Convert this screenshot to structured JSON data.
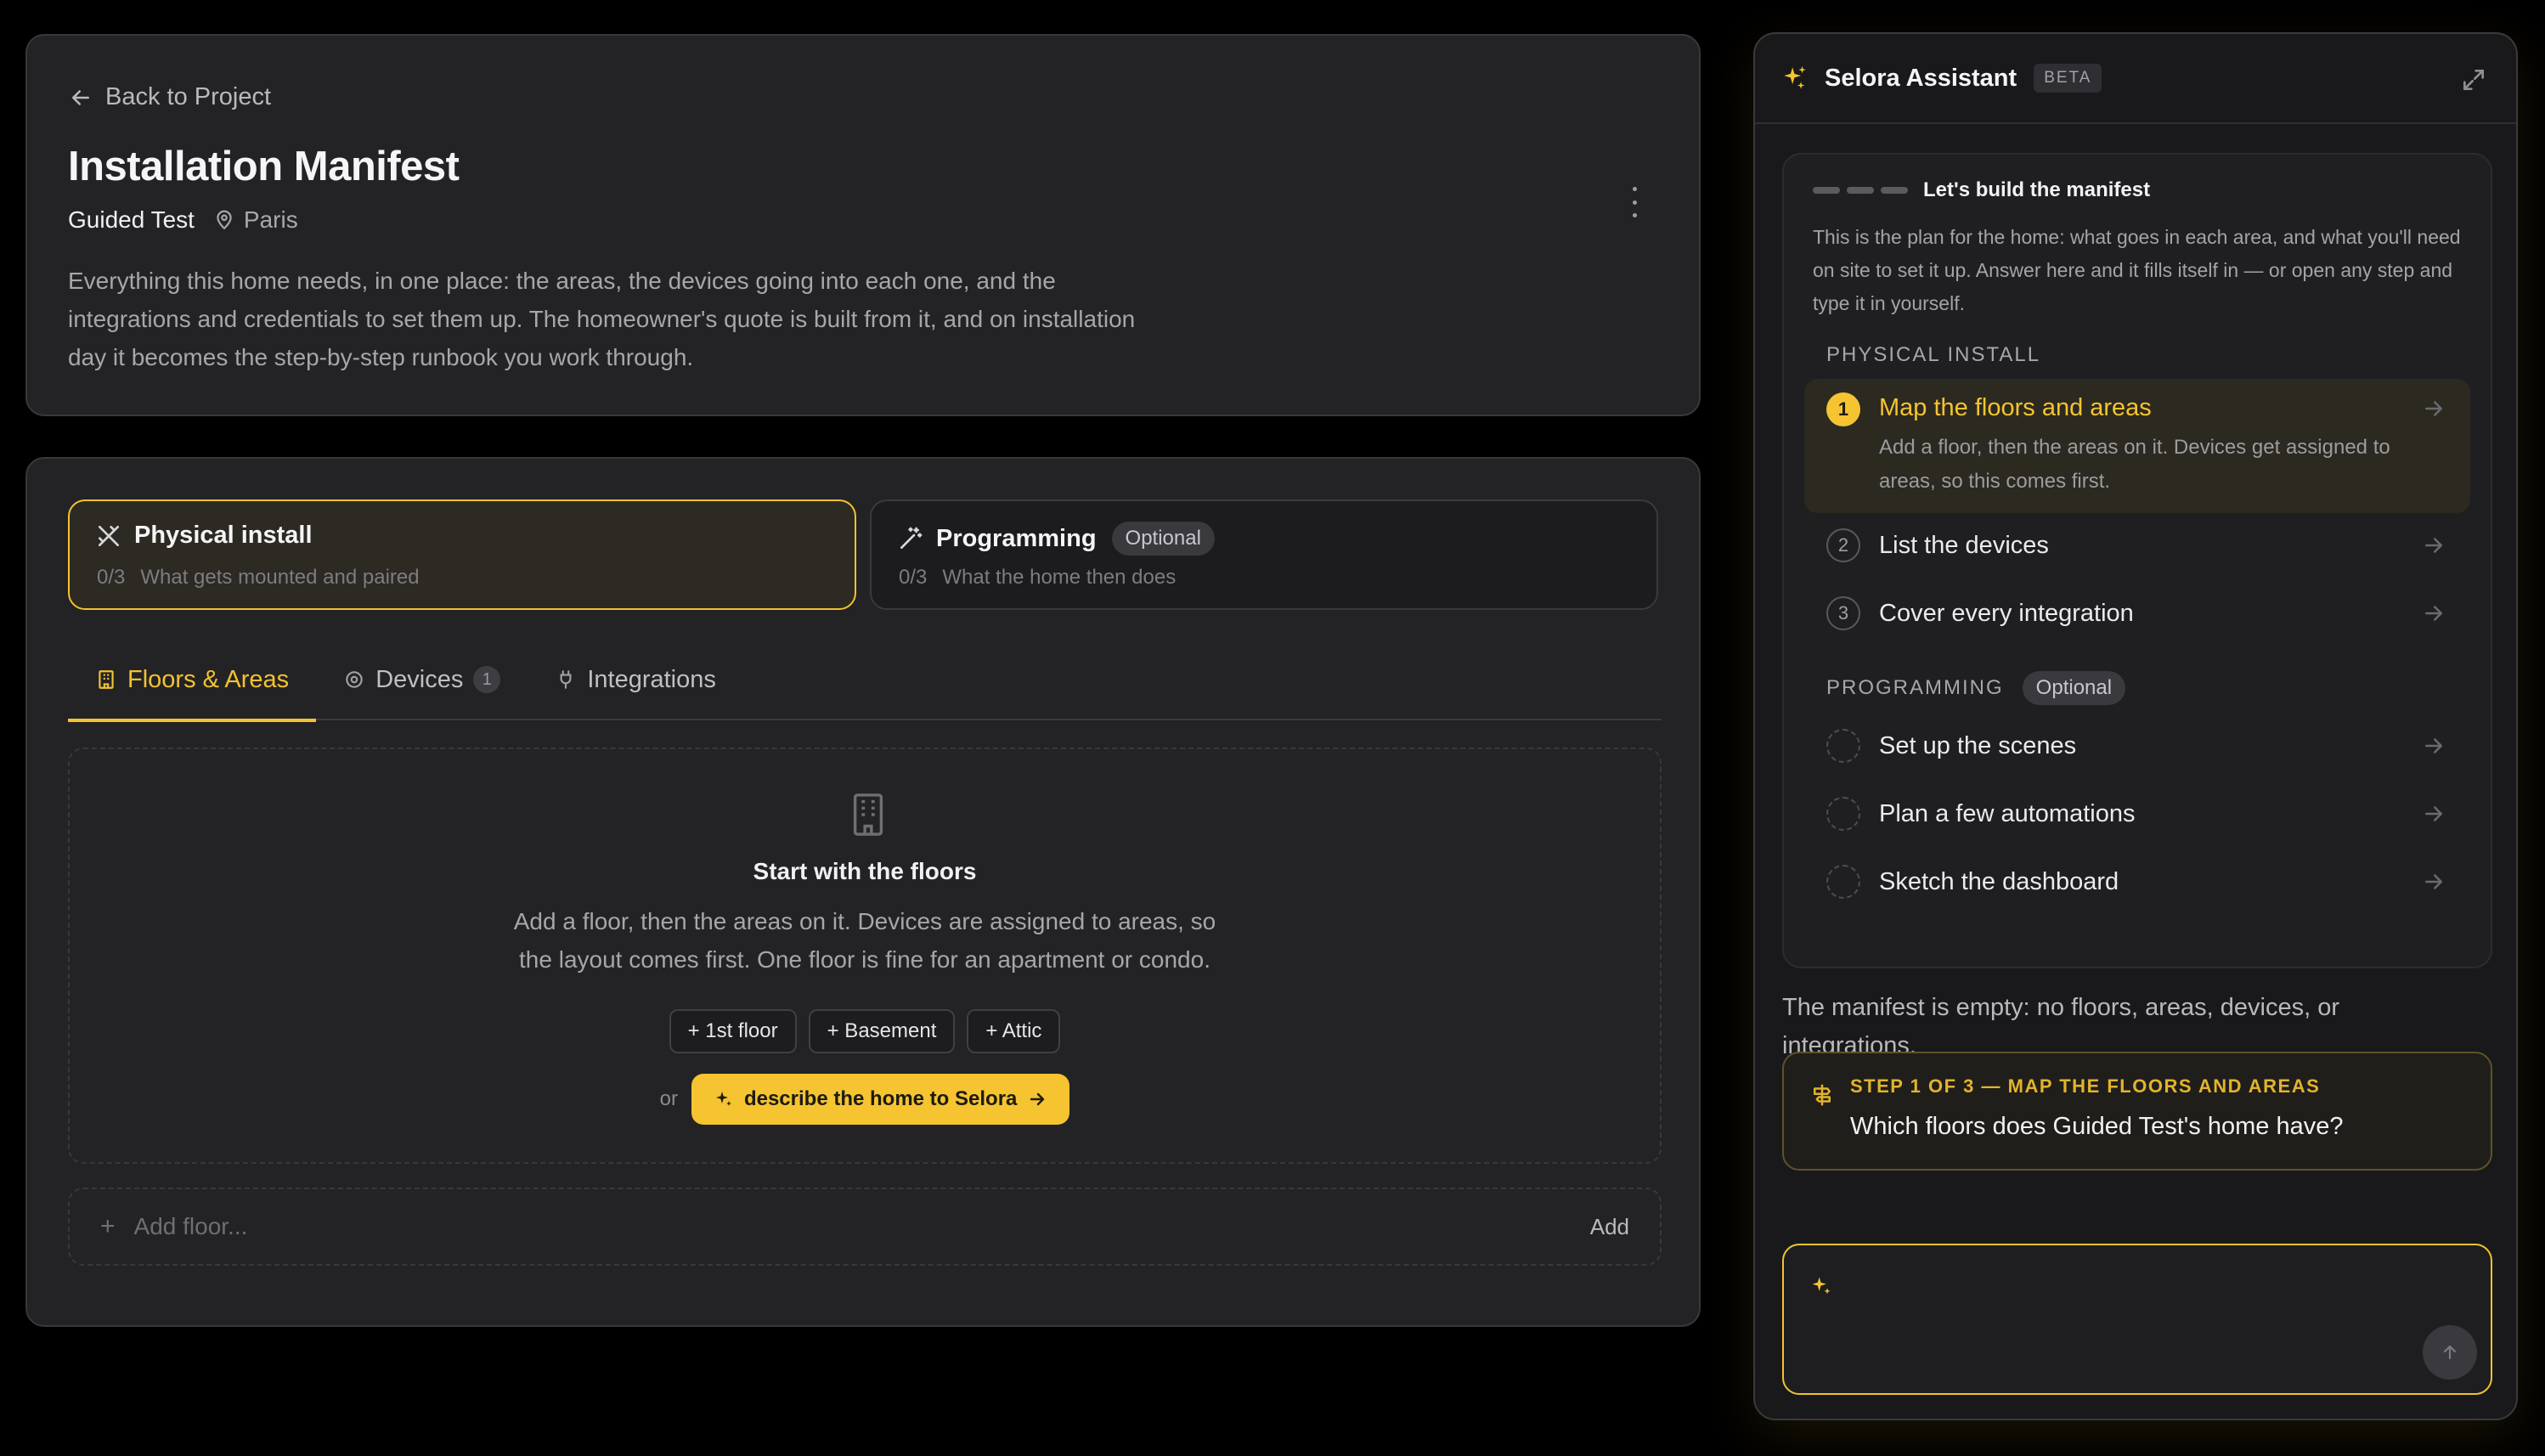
{
  "header": {
    "back_label": "Back to Project",
    "title": "Installation Manifest",
    "project_name": "Guided Test",
    "location": "Paris",
    "description": "Everything this home needs, in one place: the areas, the devices going into each one, and the integrations and credentials to set them up. The homeowner's quote is built from it, and on installation day it becomes the step-by-step runbook you work through."
  },
  "stages": [
    {
      "title": "Physical install",
      "progress": "0/3",
      "subtitle": "What gets mounted and paired",
      "icon": "tools-icon",
      "active": true
    },
    {
      "title": "Programming",
      "badge": "Optional",
      "progress": "0/3",
      "subtitle": "What the home then does",
      "icon": "wand-icon",
      "active": false
    }
  ],
  "tabs": [
    {
      "label": "Floors & Areas",
      "icon": "building-icon",
      "active": true
    },
    {
      "label": "Devices",
      "icon": "chip-icon",
      "count": "1"
    },
    {
      "label": "Integrations",
      "icon": "plug-icon"
    }
  ],
  "empty_state": {
    "title": "Start with the floors",
    "description_line1": "Add a floor, then the areas on it. Devices are assigned to areas, so",
    "description_line2": "the layout comes first. One floor is fine for an apartment or condo.",
    "quick_add": [
      "+ 1st floor",
      "+ Basement",
      "+ Attic"
    ],
    "or_label": "or",
    "describe_label": "describe the home to Selora"
  },
  "add_floor": {
    "plus": "+",
    "placeholder": "Add floor...",
    "button_label": "Add"
  },
  "assistant": {
    "title": "Selora Assistant",
    "badge": "BETA",
    "plan_title": "Let's build the manifest",
    "plan_intro": "This is the plan for the home: what goes in each area, and what you'll need on site to set it up. Answer here and it fills itself in — or open any step and type it in yourself.",
    "physical_label": "PHYSICAL INSTALL",
    "programming_label": "PROGRAMMING",
    "programming_badge": "Optional",
    "physical_steps": [
      {
        "num": "1",
        "label": "Map the floors and areas",
        "desc": "Add a floor, then the areas on it. Devices get assigned to areas, so this comes first."
      },
      {
        "num": "2",
        "label": "List the devices"
      },
      {
        "num": "3",
        "label": "Cover every integration"
      }
    ],
    "programming_steps": [
      {
        "label": "Set up the scenes"
      },
      {
        "label": "Plan a few automations"
      },
      {
        "label": "Sketch the dashboard"
      }
    ],
    "message": "The manifest is empty: no floors, areas, devices, or integrations.",
    "question_label": "STEP 1 OF 3 — MAP THE FLOORS AND AREAS",
    "question_text": "Which floors does Guided Test's home have?",
    "composer_placeholder": ""
  },
  "colors": {
    "accent": "#f5c430",
    "background": "#000000",
    "card": "#232326"
  }
}
